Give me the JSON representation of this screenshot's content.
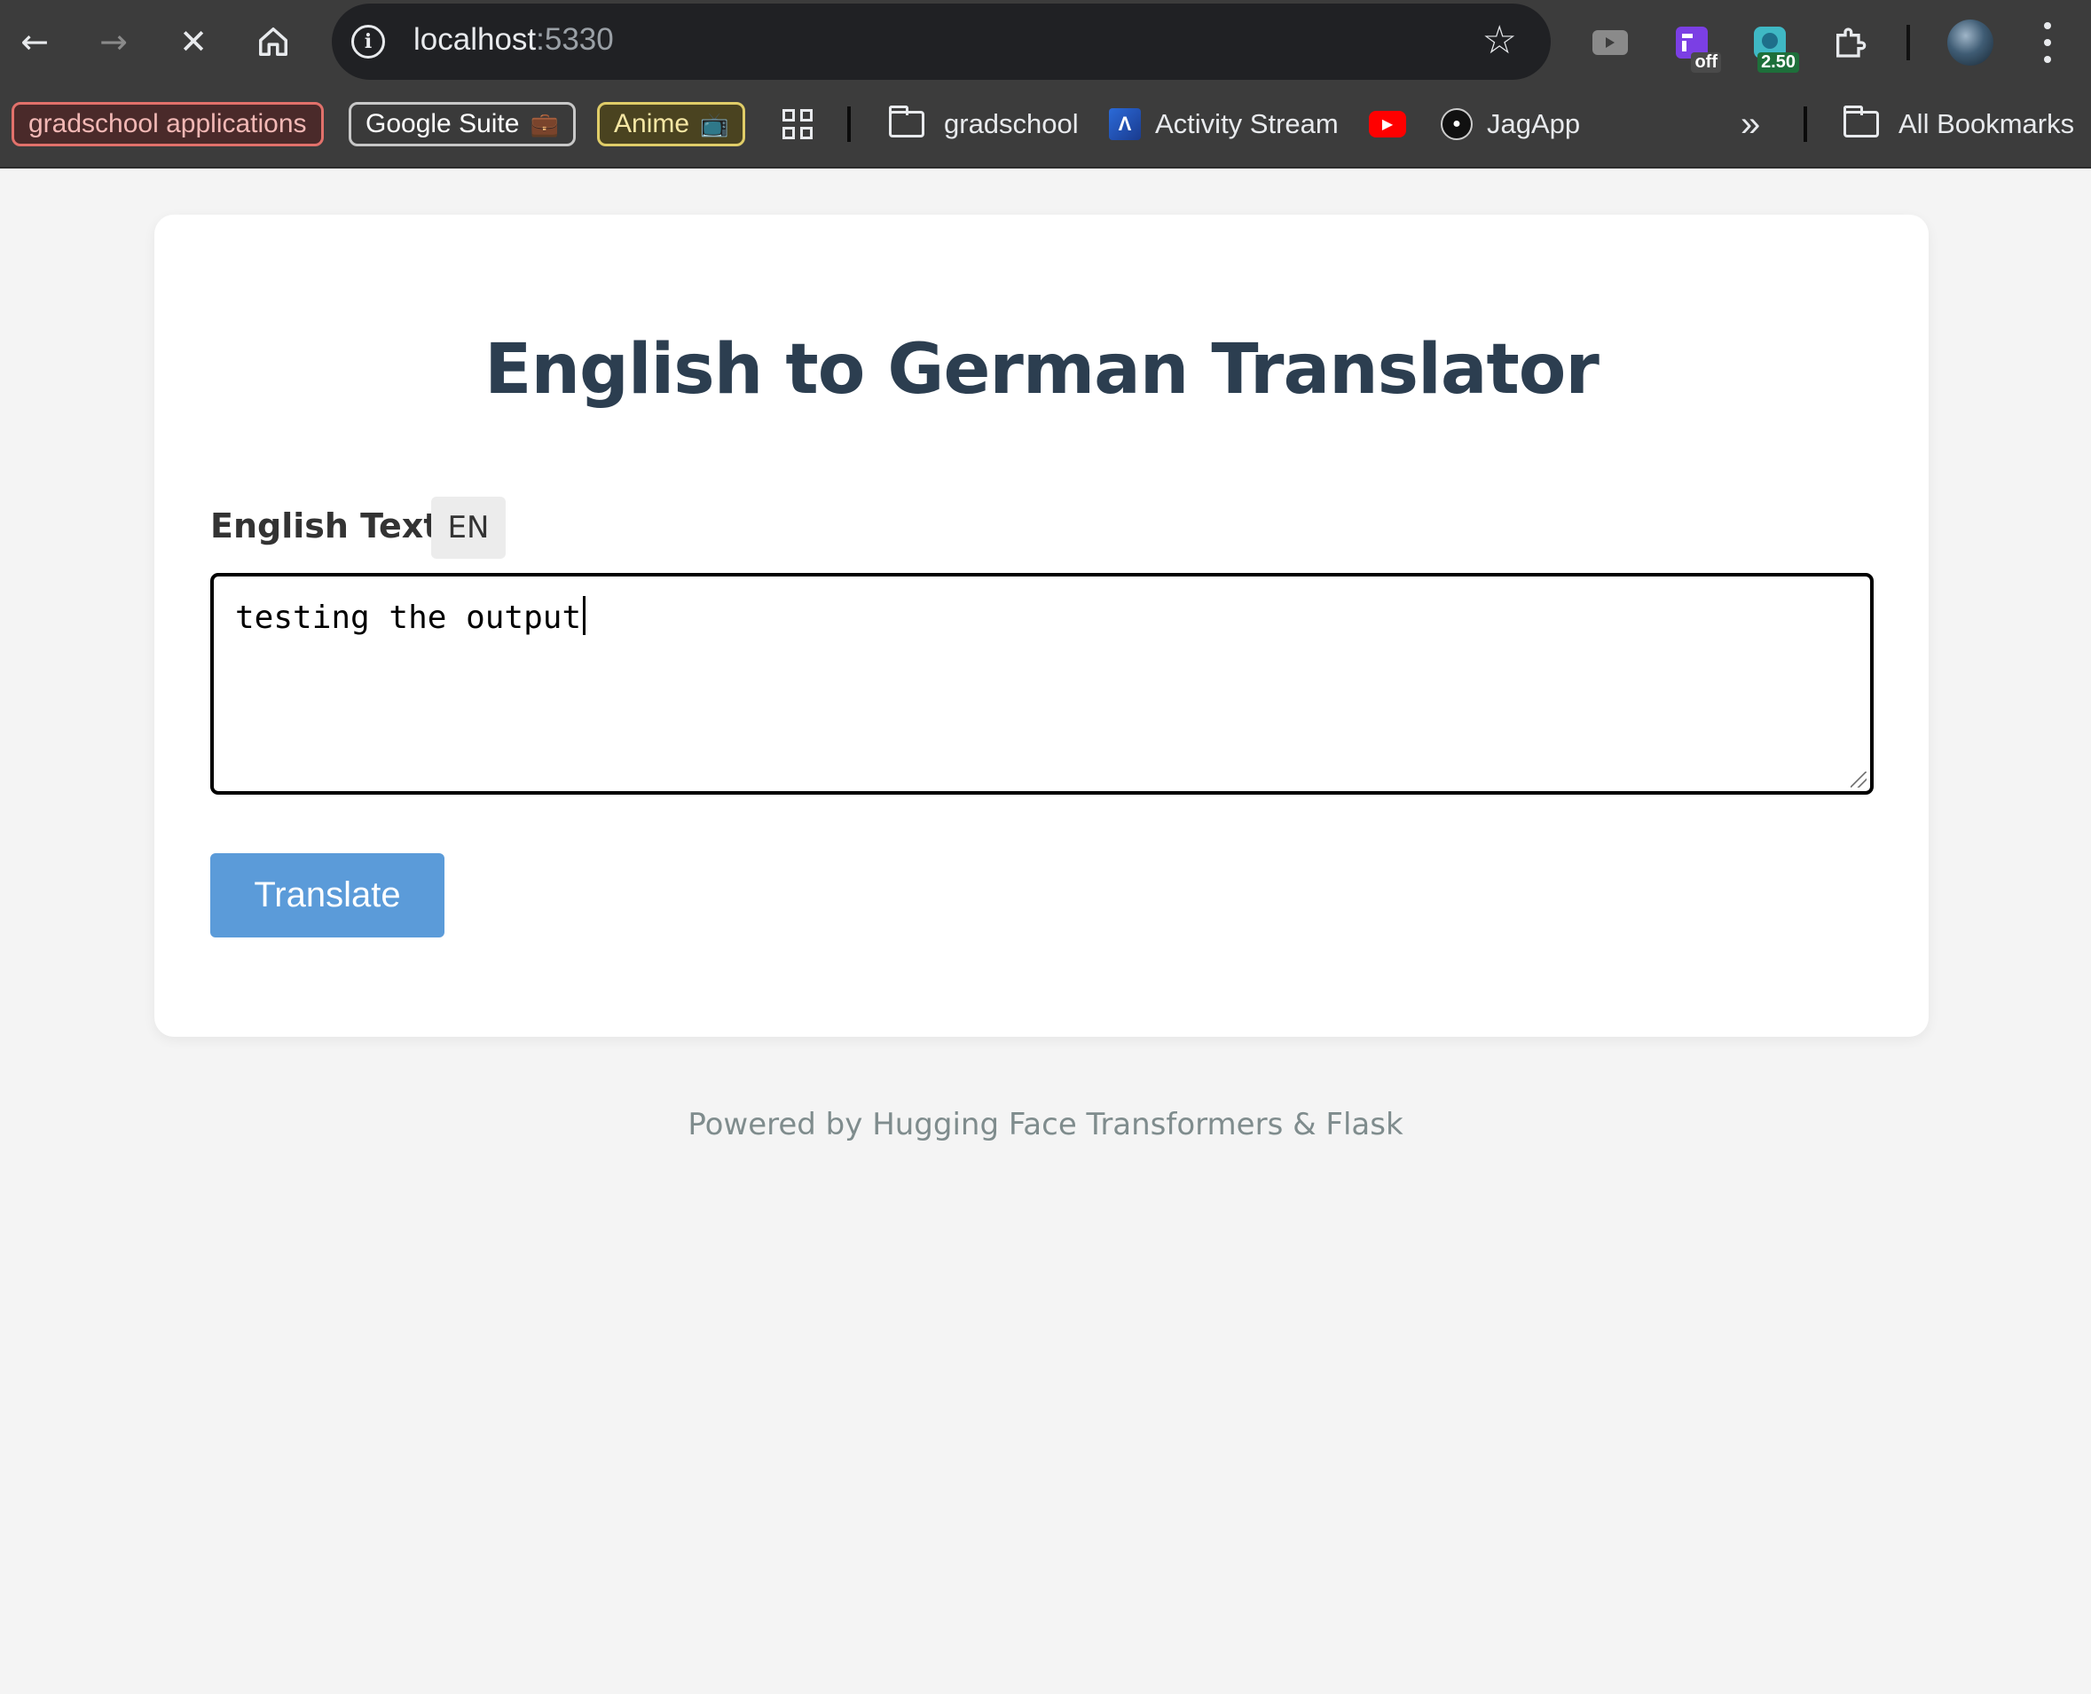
{
  "browser": {
    "url_host": "localhost",
    "url_port": ":5330",
    "extensions": {
      "ext2_badge": "off",
      "ext3_badge": "2.50"
    },
    "bookmarks": [
      {
        "label": "gradschool applications"
      },
      {
        "label": "Google Suite",
        "emoji": "💼"
      },
      {
        "label": "Anime",
        "emoji": "📺"
      },
      {
        "label": "gradschool"
      },
      {
        "label": "Activity Stream"
      },
      {
        "label": "JagApp"
      }
    ],
    "overflow_label": "»",
    "all_bookmarks_label": "All Bookmarks"
  },
  "page": {
    "title": "English to German Translator",
    "input_label": "English Text",
    "input_lang_badge": "EN",
    "input_value": "testing the output",
    "translate_label": "Translate",
    "footer": "Powered by Hugging Face Transformers & Flask"
  },
  "colors": {
    "accent": "#5b9bd9",
    "title": "#2c3e50",
    "background": "#f4f4f4"
  }
}
